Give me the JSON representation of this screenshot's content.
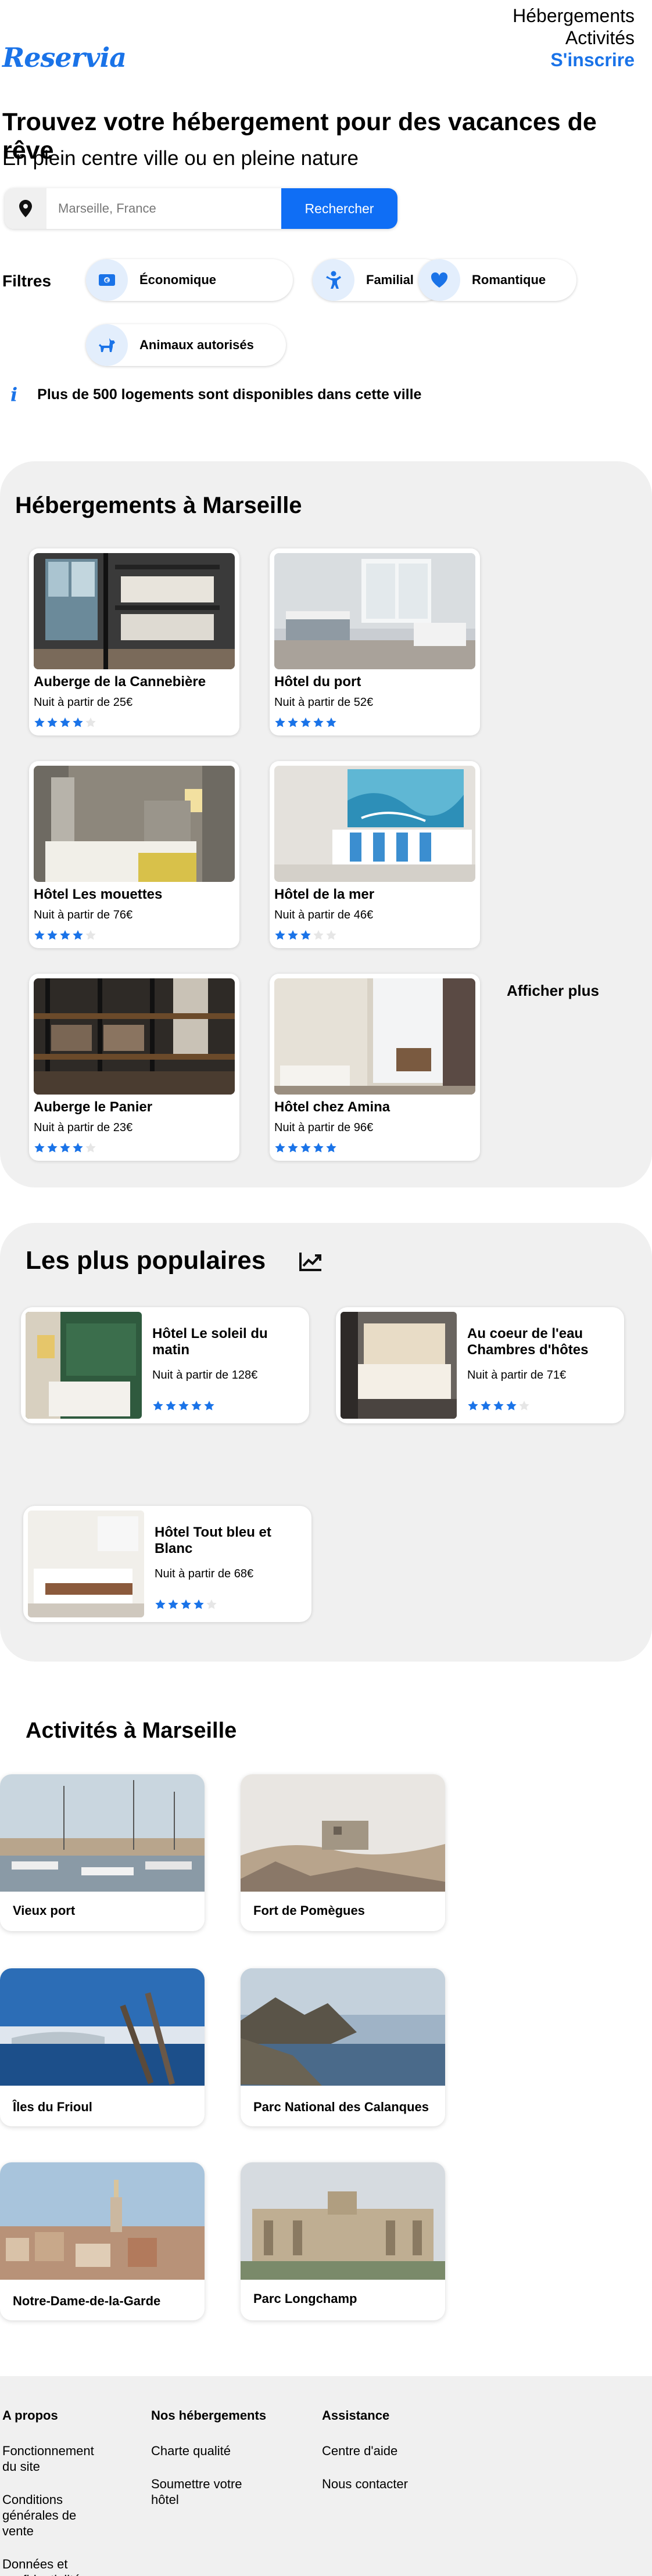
{
  "header": {
    "nav": [
      "Hébergements",
      "Activités",
      "S'inscrire"
    ],
    "logo": "Reservia"
  },
  "hero": {
    "title": "Trouvez votre hébergement pour des vacances de rêve",
    "subtitle": "En plein centre ville ou en pleine nature"
  },
  "search": {
    "placeholder": "Marseille, France",
    "button": "Rechercher"
  },
  "filters": {
    "label": "Filtres",
    "items": [
      {
        "label": "Économique",
        "icon": "money-icon"
      },
      {
        "label": "Familial",
        "icon": "child-icon"
      },
      {
        "label": "Romantique",
        "icon": "heart-icon"
      },
      {
        "label": "Animaux autorisés",
        "icon": "dog-icon"
      }
    ]
  },
  "info": {
    "text": "Plus de 500 logements sont disponibles dans cette ville"
  },
  "accommodations": {
    "title": "Hébergements à Marseille",
    "more": "Afficher plus",
    "items": [
      {
        "name": "Auberge de la Cannebière",
        "price": "Nuit à partir de 25€",
        "rating": 4
      },
      {
        "name": "Hôtel du port",
        "price": "Nuit à partir de 52€",
        "rating": 5
      },
      {
        "name": "Hôtel Les mouettes",
        "price": "Nuit à partir de 76€",
        "rating": 4
      },
      {
        "name": "Hôtel de la mer",
        "price": "Nuit à partir de 46€",
        "rating": 3
      },
      {
        "name": "Auberge le Panier",
        "price": "Nuit à partir de 23€",
        "rating": 4
      },
      {
        "name": "Hôtel chez Amina",
        "price": "Nuit à partir de 96€",
        "rating": 5
      }
    ]
  },
  "popular": {
    "title": "Les plus populaires",
    "icon": "trending-up-icon",
    "items": [
      {
        "name": "Hôtel Le soleil du matin",
        "price": "Nuit à partir de 128€",
        "rating": 5
      },
      {
        "name": "Au coeur de l'eau Chambres d'hôtes",
        "price": "Nuit à partir de 71€",
        "rating": 4
      },
      {
        "name": "Hôtel Tout bleu et Blanc",
        "price": "Nuit à partir de 68€",
        "rating": 4
      }
    ]
  },
  "activities": {
    "title": "Activités à Marseille",
    "items": [
      {
        "name": "Vieux port"
      },
      {
        "name": "Fort de Pomègues"
      },
      {
        "name": "Îles du Frioul"
      },
      {
        "name": "Parc National des Calanques"
      },
      {
        "name": "Notre-Dame-de-la-Garde"
      },
      {
        "name": "Parc Longchamp"
      }
    ]
  },
  "footer": {
    "columns": [
      {
        "title": "A propos",
        "links": [
          "Fonctionnement du site",
          "Conditions générales de vente",
          "Données et confidentialité"
        ]
      },
      {
        "title": "Nos hébergements",
        "links": [
          "Charte qualité",
          "Soumettre votre hôtel"
        ]
      },
      {
        "title": "Assistance",
        "links": [
          "Centre d'aide",
          "Nous contacter"
        ]
      }
    ]
  },
  "colors": {
    "accent": "#1a73e8",
    "button": "#0f6ef5",
    "section_bg": "#f0f0f0"
  }
}
